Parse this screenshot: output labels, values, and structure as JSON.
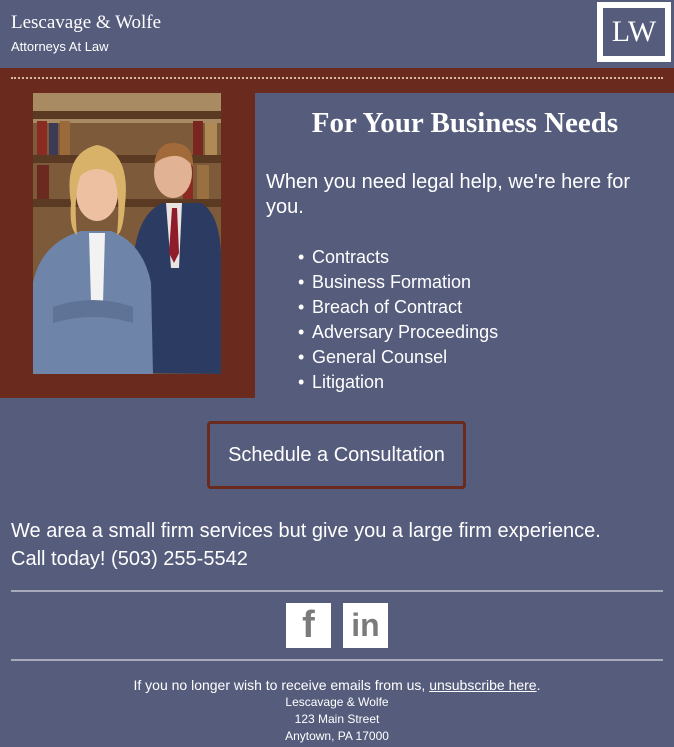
{
  "header": {
    "firm_name": "Lescavage & Wolfe",
    "tagline": "Attorneys At Law",
    "logo_text": "LW"
  },
  "hero": {
    "headline": "For Your Business Needs",
    "intro": "When you need legal help, we're here for you.",
    "services": [
      "Contracts",
      "Business Formation",
      "Breach of Contract",
      "Adversary Proceedings",
      "General Counsel",
      "Litigation"
    ]
  },
  "cta": {
    "label": "Schedule a Consultation"
  },
  "pitch": {
    "line1": "We area a small firm services but give you a large firm experience.",
    "line2": "Call today! (503) 255-5542"
  },
  "social": {
    "facebook_icon": "f",
    "linkedin_icon": "in"
  },
  "footer": {
    "unsub_prefix": "If you no longer wish to receive emails from us, ",
    "unsub_link": "unsubscribe here",
    "unsub_suffix": ".",
    "address_name": "Lescavage & Wolfe",
    "address_street": "123 Main Street",
    "address_city": "Anytown, PA 17000"
  },
  "colors": {
    "background": "#565c7c",
    "accent_brown": "#6a2a1e",
    "text": "#ffffff"
  }
}
